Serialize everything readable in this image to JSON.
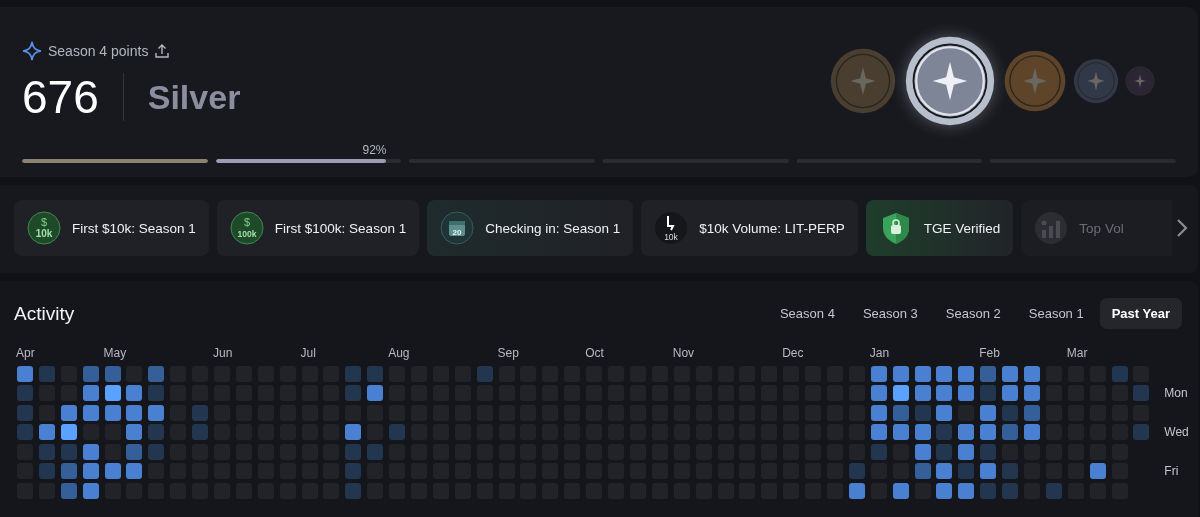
{
  "points": {
    "label": "Season 4 points",
    "value": "676",
    "tier": "Silver",
    "segments": [
      {
        "level": 1,
        "color": "#8a8272"
      },
      {
        "level": 0.92,
        "color": "#9b9eb3",
        "reading": "92%"
      },
      {
        "level": 0
      },
      {
        "level": 0
      },
      {
        "level": 0
      },
      {
        "level": 0
      }
    ],
    "medals": [
      {
        "color": "#4a3e30",
        "selected": false
      },
      {
        "color": "#b8bfcc",
        "selected": true
      },
      {
        "color": "#5e4428",
        "selected": false
      },
      {
        "color": "#313848",
        "selected": false
      },
      {
        "color": "#2c2536",
        "selected": false
      }
    ]
  },
  "achievements": [
    {
      "kind": "dollar",
      "symbol": "$",
      "badge": "10k",
      "label": "First $10k: Season 1",
      "locked": false
    },
    {
      "kind": "dollar",
      "symbol": "$",
      "badge": "100k",
      "label": "First $100k: Season 1",
      "locked": false
    },
    {
      "kind": "calendar",
      "badge": "20",
      "label": "Checking in: Season 1",
      "locked": false
    },
    {
      "kind": "volume",
      "badge": "10k",
      "label": "$10k Volume: LIT-PERP",
      "locked": false
    },
    {
      "kind": "shield",
      "label": "TGE Verified",
      "locked": false
    },
    {
      "kind": "chart",
      "label": "Top Vol",
      "locked": true
    }
  ],
  "activity": {
    "title": "Activity",
    "tabs": [
      {
        "label": "Season 4",
        "selected": false
      },
      {
        "label": "Season 3",
        "selected": false
      },
      {
        "label": "Season 2",
        "selected": false
      },
      {
        "label": "Season 1",
        "selected": false
      },
      {
        "label": "Past Year",
        "selected": true
      }
    ],
    "weeks": [
      {
        "month": "Apr",
        "days": [
          {
            "color": "#4a80d2"
          },
          {
            "color": "#233650"
          },
          {
            "color": "#233650"
          },
          {
            "color": "#233650"
          },
          {
            "color": "#222328"
          },
          {
            "color": "#222328"
          },
          {
            "color": "#222328"
          }
        ]
      },
      {
        "days": [
          {
            "color": "#233650"
          },
          {
            "color": "#222328"
          },
          {
            "color": "#222328"
          },
          {
            "color": "#4a80d2"
          },
          {
            "color": "#233650"
          },
          {
            "color": "#233650"
          },
          {
            "color": "#222328"
          }
        ]
      },
      {
        "days": [
          {
            "color": "#222328"
          },
          {
            "color": "#222328"
          },
          {
            "color": "#4a80d2"
          },
          {
            "color": "#5aa2ff"
          },
          {
            "color": "#233650"
          },
          {
            "color": "#355f98"
          },
          {
            "color": "#355f98"
          }
        ]
      },
      {
        "days": [
          {
            "color": "#355f98"
          },
          {
            "color": "#4a80d2"
          },
          {
            "color": "#4a80d2"
          },
          {
            "color": "#222328"
          },
          {
            "color": "#4a80d2"
          },
          {
            "color": "#4a80d2"
          },
          {
            "color": "#4a80d2"
          }
        ]
      },
      {
        "month": "May",
        "days": [
          {
            "color": "#355f98"
          },
          {
            "color": "#5aa2ff"
          },
          {
            "color": "#4a80d2"
          },
          {
            "color": "#222328"
          },
          {
            "color": "#222328"
          },
          {
            "color": "#4a80d2"
          },
          {
            "color": "#222328"
          }
        ]
      },
      {
        "days": [
          {
            "color": "#222328"
          },
          {
            "color": "#4a80d2"
          },
          {
            "color": "#4a80d2"
          },
          {
            "color": "#4a80d2"
          },
          {
            "color": "#355f98"
          },
          {
            "color": "#4a80d2"
          },
          {
            "color": "#222328"
          }
        ]
      },
      {
        "days": [
          {
            "color": "#355f98"
          },
          {
            "color": "#233650"
          },
          {
            "color": "#4a80d2"
          },
          {
            "color": "#233650"
          },
          {
            "color": "#233650"
          },
          {
            "color": "#222328"
          },
          {
            "color": "#222328"
          }
        ]
      },
      {
        "days": [
          {
            "color": "#222328"
          },
          {
            "color": "#222328"
          },
          {
            "color": "#222328"
          },
          {
            "color": "#222328"
          },
          {
            "color": "#222328"
          },
          {
            "color": "#222328"
          },
          {
            "color": "#222328"
          }
        ]
      },
      {
        "days": [
          {
            "color": "#222328"
          },
          {
            "color": "#222328"
          },
          {
            "color": "#233650"
          },
          {
            "color": "#233650"
          },
          {
            "color": "#222328"
          },
          {
            "color": "#222328"
          },
          {
            "color": "#222328"
          }
        ]
      },
      {
        "month": "Jun",
        "days": [
          {
            "color": "#222328"
          },
          {
            "color": "#222328"
          },
          {
            "color": "#222328"
          },
          {
            "color": "#222328"
          },
          {
            "color": "#222328"
          },
          {
            "color": "#222328"
          },
          {
            "color": "#222328"
          }
        ]
      },
      {
        "days": [
          {
            "color": "#222328"
          },
          {
            "color": "#222328"
          },
          {
            "color": "#222328"
          },
          {
            "color": "#222328"
          },
          {
            "color": "#222328"
          },
          {
            "color": "#222328"
          },
          {
            "color": "#222328"
          }
        ]
      },
      {
        "days": [
          {
            "color": "#222328"
          },
          {
            "color": "#222328"
          },
          {
            "color": "#222328"
          },
          {
            "color": "#222328"
          },
          {
            "color": "#222328"
          },
          {
            "color": "#222328"
          },
          {
            "color": "#222328"
          }
        ]
      },
      {
        "days": [
          {
            "color": "#222328"
          },
          {
            "color": "#222328"
          },
          {
            "color": "#222328"
          },
          {
            "color": "#222328"
          },
          {
            "color": "#222328"
          },
          {
            "color": "#222328"
          },
          {
            "color": "#222328"
          }
        ]
      },
      {
        "month": "Jul",
        "days": [
          {
            "color": "#222328"
          },
          {
            "color": "#222328"
          },
          {
            "color": "#222328"
          },
          {
            "color": "#222328"
          },
          {
            "color": "#222328"
          },
          {
            "color": "#222328"
          },
          {
            "color": "#222328"
          }
        ]
      },
      {
        "days": [
          {
            "color": "#222328"
          },
          {
            "color": "#222328"
          },
          {
            "color": "#222328"
          },
          {
            "color": "#222328"
          },
          {
            "color": "#222328"
          },
          {
            "color": "#222328"
          },
          {
            "color": "#222328"
          }
        ]
      },
      {
        "days": [
          {
            "color": "#233650"
          },
          {
            "color": "#233650"
          },
          {
            "color": "#222328"
          },
          {
            "color": "#4a80d2"
          },
          {
            "color": "#233650"
          },
          {
            "color": "#233650"
          },
          {
            "color": "#233650"
          }
        ]
      },
      {
        "days": [
          {
            "color": "#233650"
          },
          {
            "color": "#4a80d2"
          },
          {
            "color": "#222328"
          },
          {
            "color": "#222328"
          },
          {
            "color": "#233650"
          },
          {
            "color": "#222328"
          },
          {
            "color": "#222328"
          }
        ]
      },
      {
        "month": "Aug",
        "days": [
          {
            "color": "#222328"
          },
          {
            "color": "#222328"
          },
          {
            "color": "#222328"
          },
          {
            "color": "#233650"
          },
          {
            "color": "#222328"
          },
          {
            "color": "#222328"
          },
          {
            "color": "#222328"
          }
        ]
      },
      {
        "days": [
          {
            "color": "#222328"
          },
          {
            "color": "#222328"
          },
          {
            "color": "#222328"
          },
          {
            "color": "#222328"
          },
          {
            "color": "#222328"
          },
          {
            "color": "#222328"
          },
          {
            "color": "#222328"
          }
        ]
      },
      {
        "days": [
          {
            "color": "#222328"
          },
          {
            "color": "#222328"
          },
          {
            "color": "#222328"
          },
          {
            "color": "#222328"
          },
          {
            "color": "#222328"
          },
          {
            "color": "#222328"
          },
          {
            "color": "#222328"
          }
        ]
      },
      {
        "days": [
          {
            "color": "#222328"
          },
          {
            "color": "#222328"
          },
          {
            "color": "#222328"
          },
          {
            "color": "#222328"
          },
          {
            "color": "#222328"
          },
          {
            "color": "#222328"
          },
          {
            "color": "#222328"
          }
        ]
      },
      {
        "days": [
          {
            "color": "#233650"
          },
          {
            "color": "#222328"
          },
          {
            "color": "#222328"
          },
          {
            "color": "#222328"
          },
          {
            "color": "#222328"
          },
          {
            "color": "#222328"
          },
          {
            "color": "#222328"
          }
        ]
      },
      {
        "month": "Sep",
        "days": [
          {
            "color": "#222328"
          },
          {
            "color": "#222328"
          },
          {
            "color": "#222328"
          },
          {
            "color": "#222328"
          },
          {
            "color": "#222328"
          },
          {
            "color": "#222328"
          },
          {
            "color": "#222328"
          }
        ]
      },
      {
        "days": [
          {
            "color": "#222328"
          },
          {
            "color": "#222328"
          },
          {
            "color": "#222328"
          },
          {
            "color": "#222328"
          },
          {
            "color": "#222328"
          },
          {
            "color": "#222328"
          },
          {
            "color": "#222328"
          }
        ]
      },
      {
        "days": [
          {
            "color": "#222328"
          },
          {
            "color": "#222328"
          },
          {
            "color": "#222328"
          },
          {
            "color": "#222328"
          },
          {
            "color": "#222328"
          },
          {
            "color": "#222328"
          },
          {
            "color": "#222328"
          }
        ]
      },
      {
        "days": [
          {
            "color": "#222328"
          },
          {
            "color": "#222328"
          },
          {
            "color": "#222328"
          },
          {
            "color": "#222328"
          },
          {
            "color": "#222328"
          },
          {
            "color": "#222328"
          },
          {
            "color": "#222328"
          }
        ]
      },
      {
        "month": "Oct",
        "days": [
          {
            "color": "#222328"
          },
          {
            "color": "#222328"
          },
          {
            "color": "#222328"
          },
          {
            "color": "#222328"
          },
          {
            "color": "#222328"
          },
          {
            "color": "#222328"
          },
          {
            "color": "#222328"
          }
        ]
      },
      {
        "days": [
          {
            "color": "#222328"
          },
          {
            "color": "#222328"
          },
          {
            "color": "#222328"
          },
          {
            "color": "#222328"
          },
          {
            "color": "#222328"
          },
          {
            "color": "#222328"
          },
          {
            "color": "#222328"
          }
        ]
      },
      {
        "days": [
          {
            "color": "#222328"
          },
          {
            "color": "#222328"
          },
          {
            "color": "#222328"
          },
          {
            "color": "#222328"
          },
          {
            "color": "#222328"
          },
          {
            "color": "#222328"
          },
          {
            "color": "#222328"
          }
        ]
      },
      {
        "days": [
          {
            "color": "#222328"
          },
          {
            "color": "#222328"
          },
          {
            "color": "#222328"
          },
          {
            "color": "#222328"
          },
          {
            "color": "#222328"
          },
          {
            "color": "#222328"
          },
          {
            "color": "#222328"
          }
        ]
      },
      {
        "month": "Nov",
        "days": [
          {
            "color": "#222328"
          },
          {
            "color": "#222328"
          },
          {
            "color": "#222328"
          },
          {
            "color": "#222328"
          },
          {
            "color": "#222328"
          },
          {
            "color": "#222328"
          },
          {
            "color": "#222328"
          }
        ]
      },
      {
        "days": [
          {
            "color": "#222328"
          },
          {
            "color": "#222328"
          },
          {
            "color": "#222328"
          },
          {
            "color": "#222328"
          },
          {
            "color": "#222328"
          },
          {
            "color": "#222328"
          },
          {
            "color": "#222328"
          }
        ]
      },
      {
        "days": [
          {
            "color": "#222328"
          },
          {
            "color": "#222328"
          },
          {
            "color": "#222328"
          },
          {
            "color": "#222328"
          },
          {
            "color": "#222328"
          },
          {
            "color": "#222328"
          },
          {
            "color": "#222328"
          }
        ]
      },
      {
        "days": [
          {
            "color": "#222328"
          },
          {
            "color": "#222328"
          },
          {
            "color": "#222328"
          },
          {
            "color": "#222328"
          },
          {
            "color": "#222328"
          },
          {
            "color": "#222328"
          },
          {
            "color": "#222328"
          }
        ]
      },
      {
        "days": [
          {
            "color": "#222328"
          },
          {
            "color": "#222328"
          },
          {
            "color": "#222328"
          },
          {
            "color": "#222328"
          },
          {
            "color": "#222328"
          },
          {
            "color": "#222328"
          },
          {
            "color": "#222328"
          }
        ]
      },
      {
        "month": "Dec",
        "days": [
          {
            "color": "#222328"
          },
          {
            "color": "#222328"
          },
          {
            "color": "#222328"
          },
          {
            "color": "#222328"
          },
          {
            "color": "#222328"
          },
          {
            "color": "#222328"
          },
          {
            "color": "#222328"
          }
        ]
      },
      {
        "days": [
          {
            "color": "#222328"
          },
          {
            "color": "#222328"
          },
          {
            "color": "#222328"
          },
          {
            "color": "#222328"
          },
          {
            "color": "#222328"
          },
          {
            "color": "#222328"
          },
          {
            "color": "#222328"
          }
        ]
      },
      {
        "days": [
          {
            "color": "#222328"
          },
          {
            "color": "#222328"
          },
          {
            "color": "#222328"
          },
          {
            "color": "#222328"
          },
          {
            "color": "#222328"
          },
          {
            "color": "#222328"
          },
          {
            "color": "#222328"
          }
        ]
      },
      {
        "days": [
          {
            "color": "#222328"
          },
          {
            "color": "#222328"
          },
          {
            "color": "#222328"
          },
          {
            "color": "#222328"
          },
          {
            "color": "#222328"
          },
          {
            "color": "#233650"
          },
          {
            "color": "#4a80d2"
          }
        ]
      },
      {
        "month": "Jan",
        "days": [
          {
            "color": "#4a80d2"
          },
          {
            "color": "#4a80d2"
          },
          {
            "color": "#4a80d2"
          },
          {
            "color": "#4a80d2"
          },
          {
            "color": "#233650"
          },
          {
            "color": "#222328"
          },
          {
            "color": "#222328"
          }
        ]
      },
      {
        "days": [
          {
            "color": "#4a80d2"
          },
          {
            "color": "#5aa2ff"
          },
          {
            "color": "#355f98"
          },
          {
            "color": "#4a80d2"
          },
          {
            "color": "#222328"
          },
          {
            "color": "#222328"
          },
          {
            "color": "#4a80d2"
          }
        ]
      },
      {
        "days": [
          {
            "color": "#4a80d2"
          },
          {
            "color": "#4a80d2"
          },
          {
            "color": "#233650"
          },
          {
            "color": "#4a80d2"
          },
          {
            "color": "#4a80d2"
          },
          {
            "color": "#355f98"
          },
          {
            "color": "#222328"
          }
        ]
      },
      {
        "days": [
          {
            "color": "#4a80d2"
          },
          {
            "color": "#4a80d2"
          },
          {
            "color": "#4a80d2"
          },
          {
            "color": "#233650"
          },
          {
            "color": "#233650"
          },
          {
            "color": "#4a80d2"
          },
          {
            "color": "#4a80d2"
          }
        ]
      },
      {
        "days": [
          {
            "color": "#4a80d2"
          },
          {
            "color": "#4a80d2"
          },
          {
            "color": "#222328"
          },
          {
            "color": "#4a80d2"
          },
          {
            "color": "#4a80d2"
          },
          {
            "color": "#233650"
          },
          {
            "color": "#4a80d2"
          }
        ]
      },
      {
        "month": "Feb",
        "days": [
          {
            "color": "#355f98"
          },
          {
            "color": "#233650"
          },
          {
            "color": "#4a80d2"
          },
          {
            "color": "#4a80d2"
          },
          {
            "color": "#233650"
          },
          {
            "color": "#4a80d2"
          },
          {
            "color": "#233650"
          }
        ]
      },
      {
        "days": [
          {
            "color": "#4a80d2"
          },
          {
            "color": "#4a80d2"
          },
          {
            "color": "#233650"
          },
          {
            "color": "#355f98"
          },
          {
            "color": "#222328"
          },
          {
            "color": "#233650"
          },
          {
            "color": "#233650"
          }
        ]
      },
      {
        "days": [
          {
            "color": "#4a80d2"
          },
          {
            "color": "#4a80d2"
          },
          {
            "color": "#355f98"
          },
          {
            "color": "#4a80d2"
          },
          {
            "color": "#222328"
          },
          {
            "color": "#222328"
          },
          {
            "color": "#222328"
          }
        ]
      },
      {
        "days": [
          {
            "color": "#222328"
          },
          {
            "color": "#222328"
          },
          {
            "color": "#222328"
          },
          {
            "color": "#222328"
          },
          {
            "color": "#222328"
          },
          {
            "color": "#222328"
          },
          {
            "color": "#233650"
          }
        ]
      },
      {
        "month": "Mar",
        "days": [
          {
            "color": "#222328"
          },
          {
            "color": "#222328"
          },
          {
            "color": "#222328"
          },
          {
            "color": "#222328"
          },
          {
            "color": "#222328"
          },
          {
            "color": "#222328"
          },
          {
            "color": "#222328"
          }
        ]
      },
      {
        "days": [
          {
            "color": "#222328"
          },
          {
            "color": "#222328"
          },
          {
            "color": "#222328"
          },
          {
            "color": "#222328"
          },
          {
            "color": "#222328"
          },
          {
            "color": "#4a80d2"
          },
          {
            "color": "#222328"
          }
        ]
      },
      {
        "days": [
          {
            "color": "#233650"
          },
          {
            "color": "#222328"
          },
          {
            "color": "#222328"
          },
          {
            "color": "#222328"
          },
          {
            "color": "#222328"
          },
          {
            "color": "#222328"
          },
          {
            "color": "#222328"
          }
        ]
      },
      {
        "days": [
          {
            "color": "#222328"
          },
          {
            "color": "#233650"
          },
          {
            "color": "#222328"
          },
          {
            "color": "#233650"
          }
        ]
      }
    ],
    "day_labels": [
      "Mon",
      "Wed",
      "Fri"
    ]
  }
}
